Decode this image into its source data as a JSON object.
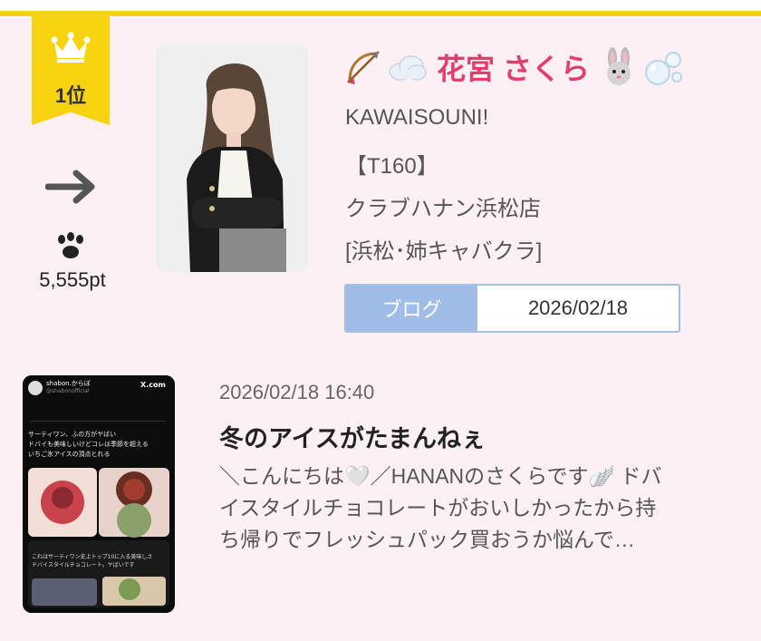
{
  "ranking": {
    "rank_label": "1位",
    "points": "5,555pt",
    "crown_color": "#f6d20f"
  },
  "cast": {
    "name": "花宮 さくら",
    "catchphrase": "KAWAISOUNI!",
    "height": "【T160】",
    "shop": "クラブハナン浜松店",
    "area": "[浜松･姉キャバクラ]",
    "name_color": "#e33d6e",
    "name_icons": [
      "bow-and-arrow-icon",
      "cloud-icon",
      "rabbit-icon",
      "bubbles-icon"
    ]
  },
  "blog": {
    "tab_label": "ブログ",
    "date": "2026/02/18"
  },
  "post": {
    "timestamp": "2026/02/18 16:40",
    "title": "冬のアイスがたまんねぇ",
    "excerpt_lines": [
      "＼こんにちは🤍／HANANのさくらです🪽 ドバ",
      "イスタイルチョコレートがおいしかったから持",
      "ち帰りでフレッシュパック買おうか悩んで…"
    ],
    "thumb_text": {
      "account": "shabon.からぼ",
      "handle": "@shabonofficial",
      "brand": "X.com",
      "caption_lines": [
        "サーティワン、ふの方がヤばい",
        "ドバイも美味しいけどコレは季節を超える",
        "いちご氷アイスの頂点とれる"
      ],
      "quote_lines": [
        "これはサーティワン史上トップ10に入る美味しさ",
        "ドバイスタイルチョコレート。ヤばいです"
      ]
    }
  },
  "colors": {
    "background": "#fdf0f4",
    "accent_yellow": "#f5d21a",
    "blog_tab": "#9fbde6"
  }
}
